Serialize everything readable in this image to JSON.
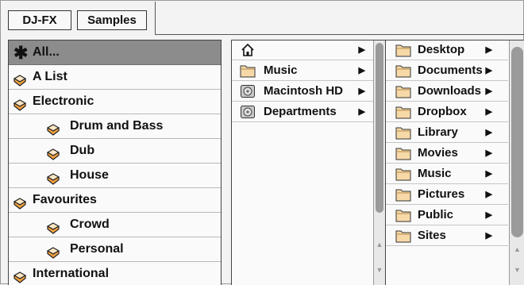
{
  "tabs": [
    {
      "label": "DJ-FX"
    },
    {
      "label": "Samples"
    }
  ],
  "categories": [
    {
      "label": "All...",
      "icon": "star-icon",
      "indent": 0,
      "selected": true
    },
    {
      "label": "A List",
      "icon": "category-tag-icon",
      "indent": 0
    },
    {
      "label": "Electronic",
      "icon": "category-tag-icon",
      "indent": 0
    },
    {
      "label": "Drum and Bass",
      "icon": "category-tag-icon",
      "indent": 1
    },
    {
      "label": "Dub",
      "icon": "category-tag-icon",
      "indent": 1
    },
    {
      "label": "House",
      "icon": "category-tag-icon",
      "indent": 1
    },
    {
      "label": "Favourites",
      "icon": "category-tag-icon",
      "indent": 0
    },
    {
      "label": "Crowd",
      "icon": "category-tag-icon",
      "indent": 1
    },
    {
      "label": "Personal",
      "icon": "category-tag-icon",
      "indent": 1
    },
    {
      "label": "International",
      "icon": "category-tag-icon",
      "indent": 0
    }
  ],
  "locations": [
    {
      "label": "",
      "icon": "home-icon",
      "has_children": true
    },
    {
      "label": "Music",
      "icon": "folder-icon",
      "has_children": true
    },
    {
      "label": "Macintosh HD",
      "icon": "drive-icon",
      "has_children": true
    },
    {
      "label": "Departments",
      "icon": "drive-icon",
      "has_children": true
    }
  ],
  "folders": [
    {
      "label": "Desktop",
      "icon": "folder-icon",
      "has_children": true
    },
    {
      "label": "Documents",
      "icon": "folder-icon",
      "has_children": true
    },
    {
      "label": "Downloads",
      "icon": "folder-icon",
      "has_children": true
    },
    {
      "label": "Dropbox",
      "icon": "folder-icon",
      "has_children": true
    },
    {
      "label": "Library",
      "icon": "folder-icon",
      "has_children": true
    },
    {
      "label": "Movies",
      "icon": "folder-icon",
      "has_children": true
    },
    {
      "label": "Music",
      "icon": "folder-icon",
      "has_children": true
    },
    {
      "label": "Pictures",
      "icon": "folder-icon",
      "has_children": true
    },
    {
      "label": "Public",
      "icon": "folder-icon",
      "has_children": true
    },
    {
      "label": "Sites",
      "icon": "folder-icon",
      "has_children": true
    }
  ],
  "colors": {
    "selected_row": "#8c8c8c",
    "tag_orange": "#f4a340",
    "folder_fill": "#f7d9a8",
    "scroll_thumb": "#9a9a9a"
  }
}
